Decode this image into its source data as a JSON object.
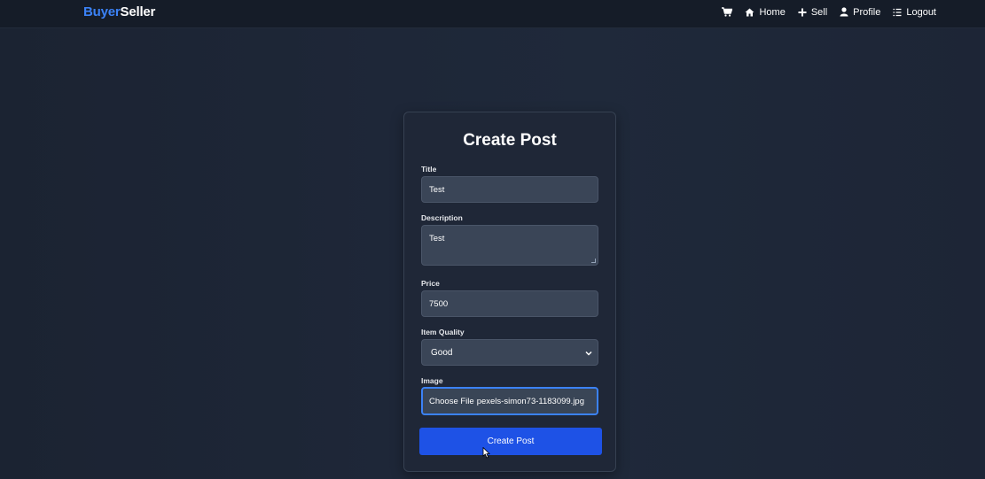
{
  "navbar": {
    "brand_part1": "Buyer",
    "brand_part2": "Seller",
    "links": [
      {
        "icon": "cart-icon",
        "label": ""
      },
      {
        "icon": "home-icon",
        "label": "Home"
      },
      {
        "icon": "plus-icon",
        "label": "Sell"
      },
      {
        "icon": "user-icon",
        "label": "Profile"
      },
      {
        "icon": "list-icon",
        "label": "Logout"
      }
    ]
  },
  "form": {
    "heading": "Create Post",
    "title_label": "Title",
    "title_value": "Test",
    "description_label": "Description",
    "description_value": "Test",
    "price_label": "Price",
    "price_value": "7500",
    "quality_label": "Item Quality",
    "quality_value": "Good",
    "image_label": "Image",
    "image_button": "Choose File",
    "image_filename": "pexels-simon73-1183099.jpg",
    "submit_label": "Create Post"
  },
  "colors": {
    "accent": "#3b82f6",
    "button": "#1e52e6",
    "navbar_bg": "#151c28",
    "card_bg": "#1f2737"
  }
}
